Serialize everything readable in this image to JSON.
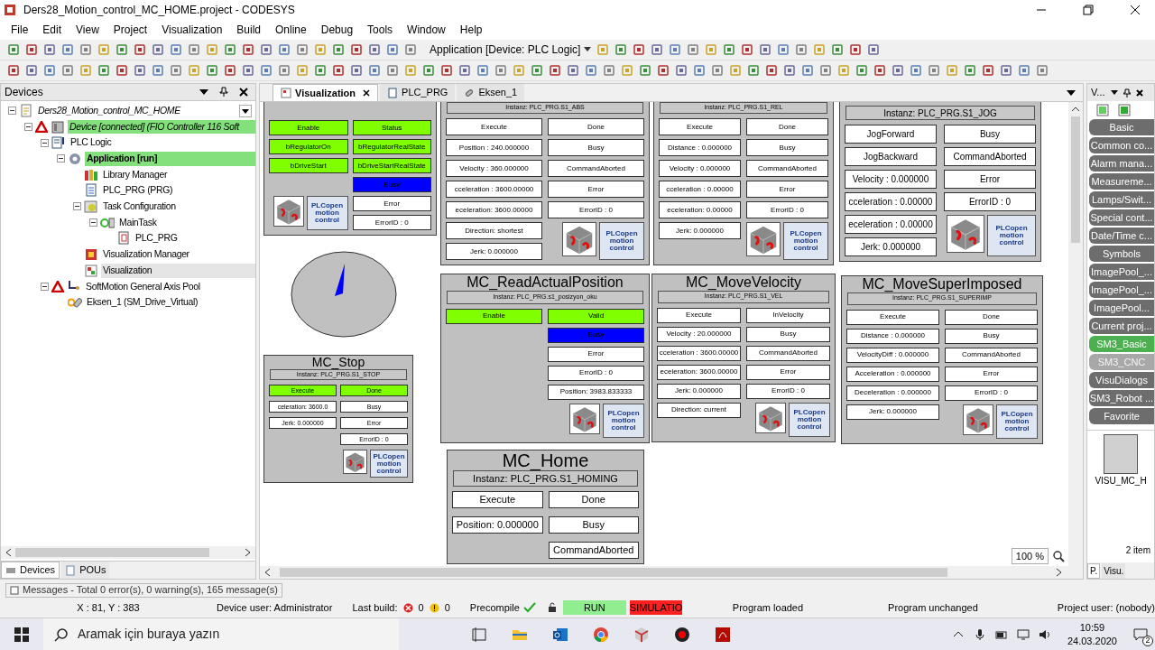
{
  "window": {
    "title": "Ders28_Motion_control_MC_HOME.project - CODESYS"
  },
  "menu": [
    "File",
    "Edit",
    "View",
    "Project",
    "Visualization",
    "Build",
    "Online",
    "Debug",
    "Tools",
    "Window",
    "Help"
  ],
  "toolbar": {
    "application": "Application [Device: PLC Logic]"
  },
  "devices_panel": {
    "title": "Devices",
    "tree": [
      {
        "label": "Ders28_Motion_control_MC_HOME",
        "kind": "project",
        "expanded": true,
        "children": [
          {
            "label": "Device [connected] (FIO Controller 116 Soft",
            "kind": "device",
            "warning": true,
            "highlighted": true,
            "expanded": true,
            "children": [
              {
                "label": "PLC Logic",
                "kind": "plc",
                "expanded": true,
                "children": [
                  {
                    "label": "Application [run]",
                    "kind": "application",
                    "highlighted": true,
                    "expanded": true,
                    "children": [
                      {
                        "label": "Library Manager",
                        "kind": "library"
                      },
                      {
                        "label": "PLC_PRG (PRG)",
                        "kind": "pou"
                      },
                      {
                        "label": "Task Configuration",
                        "kind": "taskconfig",
                        "expanded": true,
                        "children": [
                          {
                            "label": "MainTask",
                            "kind": "task",
                            "expanded": true,
                            "children": [
                              {
                                "label": "PLC_PRG",
                                "kind": "call"
                              }
                            ]
                          }
                        ]
                      },
                      {
                        "label": "Visualization Manager",
                        "kind": "visumanager"
                      },
                      {
                        "label": "Visualization",
                        "kind": "visu",
                        "selected": true
                      }
                    ]
                  }
                ]
              },
              {
                "label": "SoftMotion General Axis Pool",
                "kind": "axispool",
                "warning": true,
                "expanded": true,
                "children": [
                  {
                    "label": "Eksen_1 (SM_Drive_Virtual)",
                    "kind": "axis"
                  }
                ]
              }
            ]
          }
        ]
      }
    ]
  },
  "bottom_tabs": [
    {
      "label": "Devices",
      "selected": true
    },
    {
      "label": "POUs",
      "selected": false
    }
  ],
  "editor_tabs": [
    {
      "label": "Visualization",
      "selected": true
    },
    {
      "label": "PLC_PRG",
      "selected": false
    },
    {
      "label": "Eksen_1",
      "selected": false
    }
  ],
  "visualization": {
    "blocks": [
      {
        "left": [
          {
            "kind": "cell",
            "text": "Enable",
            "color": "#80ff00"
          },
          {
            "kind": "cell",
            "text": "bRegulatorOn",
            "color": "#80ff00"
          },
          {
            "kind": "cell",
            "text": "bDriveStart",
            "color": "#80ff00"
          },
          {
            "kind": "blank"
          },
          {
            "kind": "logos",
            "brand": "PLCopen",
            "caption": "motion control"
          }
        ],
        "right": [
          {
            "kind": "cell",
            "text": "Status",
            "color": "#80ff00"
          },
          {
            "kind": "cell",
            "text": "bRegulatorRealState",
            "color": "#80ff00"
          },
          {
            "kind": "cell",
            "text": "bDriveStartRealState",
            "color": "#80ff00"
          },
          {
            "kind": "cell",
            "text": "Busy",
            "color": "#0000ff"
          },
          {
            "kind": "cell",
            "text": "Error",
            "color": "#ffffff"
          },
          {
            "kind": "cell",
            "text": "ErrorID : 0",
            "color": "#ffffff"
          }
        ]
      },
      {
        "instance": "Instanz: PLC_PRG.S1_ABS",
        "left": [
          {
            "kind": "cell",
            "text": "Execute",
            "color": "#ffffff"
          },
          {
            "kind": "cell",
            "text": "Position : 240.000000",
            "color": "#ffffff"
          },
          {
            "kind": "cell",
            "text": "Velocity : 360.000000",
            "color": "#ffffff"
          },
          {
            "kind": "cell",
            "text": "cceleration : 3600.00000",
            "color": "#ffffff"
          },
          {
            "kind": "cell",
            "text": "eceleration: 3600.00000",
            "color": "#ffffff"
          },
          {
            "kind": "cell",
            "text": "Direction: shortest",
            "color": "#ffffff"
          },
          {
            "kind": "cell",
            "text": "Jerk: 0.000000",
            "color": "#ffffff"
          }
        ],
        "right": [
          {
            "kind": "cell",
            "text": "Done",
            "color": "#ffffff"
          },
          {
            "kind": "cell",
            "text": "Busy",
            "color": "#ffffff"
          },
          {
            "kind": "cell",
            "text": "CommandAborted",
            "color": "#ffffff"
          },
          {
            "kind": "cell",
            "text": "Error",
            "color": "#ffffff"
          },
          {
            "kind": "cell",
            "text": "ErrorID : 0",
            "color": "#ffffff"
          },
          {
            "kind": "logos",
            "brand": "PLCopen",
            "caption": "motion control"
          }
        ]
      },
      {
        "instance": "Instanz: PLC_PRG.S1_REL",
        "left": [
          {
            "kind": "cell",
            "text": "Execute",
            "color": "#ffffff"
          },
          {
            "kind": "cell",
            "text": "Distance : 0.000000",
            "color": "#ffffff"
          },
          {
            "kind": "cell",
            "text": "Velocity : 0.000000",
            "color": "#ffffff"
          },
          {
            "kind": "cell",
            "text": "cceleration : 0.00000",
            "color": "#ffffff"
          },
          {
            "kind": "cell",
            "text": "eceleration: 0.00000",
            "color": "#ffffff"
          },
          {
            "kind": "cell",
            "text": "Jerk: 0.000000",
            "color": "#ffffff"
          }
        ],
        "right": [
          {
            "kind": "cell",
            "text": "Done",
            "color": "#ffffff"
          },
          {
            "kind": "cell",
            "text": "Busy",
            "color": "#ffffff"
          },
          {
            "kind": "cell",
            "text": "CommandAborted",
            "color": "#ffffff"
          },
          {
            "kind": "cell",
            "text": "Error",
            "color": "#ffffff"
          },
          {
            "kind": "cell",
            "text": "ErrorID : 0",
            "color": "#ffffff"
          },
          {
            "kind": "logos",
            "brand": "PLCopen",
            "caption": "motion control"
          }
        ]
      },
      {
        "instance": "Instanz: PLC_PRG.S1_JOG",
        "left": [
          {
            "kind": "cell",
            "text": "JogForward",
            "color": "#ffffff"
          },
          {
            "kind": "cell",
            "text": "JogBackward",
            "color": "#ffffff"
          },
          {
            "kind": "cell",
            "text": "Velocity : 0.000000",
            "color": "#ffffff"
          },
          {
            "kind": "cell",
            "text": "cceleration : 0.00000",
            "color": "#ffffff"
          },
          {
            "kind": "cell",
            "text": "eceleration : 0.00000",
            "color": "#ffffff"
          },
          {
            "kind": "cell",
            "text": "Jerk: 0.000000",
            "color": "#ffffff"
          }
        ],
        "right": [
          {
            "kind": "cell",
            "text": "Busy",
            "color": "#ffffff"
          },
          {
            "kind": "cell",
            "text": "CommandAborted",
            "color": "#ffffff"
          },
          {
            "kind": "cell",
            "text": "Error",
            "color": "#ffffff"
          },
          {
            "kind": "cell",
            "text": "ErrorID : 0",
            "color": "#ffffff"
          },
          {
            "kind": "logos",
            "brand": "PLCopen",
            "caption": "motion control"
          }
        ]
      },
      {
        "title": "MC_Stop",
        "instance": "Instanz: PLC_PRG.S1_STOP",
        "left": [
          {
            "kind": "cell",
            "text": "Execute",
            "color": "#80ff00"
          },
          {
            "kind": "cell",
            "text": "celeration: 3600.0",
            "color": "#ffffff"
          },
          {
            "kind": "cell",
            "text": "Jerk: 0.000000",
            "color": "#ffffff"
          }
        ],
        "right": [
          {
            "kind": "cell",
            "text": "Done",
            "color": "#80ff00"
          },
          {
            "kind": "cell",
            "text": "Busy",
            "color": "#ffffff"
          },
          {
            "kind": "cell",
            "text": "Error",
            "color": "#ffffff"
          },
          {
            "kind": "cell",
            "text": "ErrorID : 0",
            "color": "#ffffff"
          },
          {
            "kind": "logos",
            "brand": "PLCopen",
            "caption": "motion control"
          }
        ]
      },
      {
        "title": "MC_ReadActualPosition",
        "instance": "Instanz: PLC_PRG.s1_posizyon_oku",
        "left": [
          {
            "kind": "cell",
            "text": "Enable",
            "color": "#80ff00"
          }
        ],
        "right": [
          {
            "kind": "cell",
            "text": "Valid",
            "color": "#80ff00"
          },
          {
            "kind": "cell",
            "text": "Busy",
            "color": "#0000ff"
          },
          {
            "kind": "cell",
            "text": "Error",
            "color": "#ffffff"
          },
          {
            "kind": "cell",
            "text": "ErrorID : 0",
            "color": "#ffffff"
          },
          {
            "kind": "cell",
            "text": "Position: 3983.833333",
            "color": "#ffffff"
          },
          {
            "kind": "logos",
            "brand": "PLCopen",
            "caption": "motion control"
          }
        ]
      },
      {
        "title": "MC_MoveVelocity",
        "instance": "Instanz: PLC_PRG.S1_VEL",
        "left": [
          {
            "kind": "cell",
            "text": "Execute",
            "color": "#ffffff"
          },
          {
            "kind": "cell",
            "text": "Velocity : 20.000000",
            "color": "#ffffff"
          },
          {
            "kind": "cell",
            "text": "cceleration : 3600.00000",
            "color": "#ffffff"
          },
          {
            "kind": "cell",
            "text": "eceleration: 3600.00000",
            "color": "#ffffff"
          },
          {
            "kind": "cell",
            "text": "Jerk: 0.000000",
            "color": "#ffffff"
          },
          {
            "kind": "cell",
            "text": "Direction: current",
            "color": "#ffffff"
          }
        ],
        "right": [
          {
            "kind": "cell",
            "text": "InVelocity",
            "color": "#ffffff"
          },
          {
            "kind": "cell",
            "text": "Busy",
            "color": "#ffffff"
          },
          {
            "kind": "cell",
            "text": "CommandAborted",
            "color": "#ffffff"
          },
          {
            "kind": "cell",
            "text": "Error",
            "color": "#ffffff"
          },
          {
            "kind": "cell",
            "text": "ErrorID : 0",
            "color": "#ffffff"
          },
          {
            "kind": "logos",
            "brand": "PLCopen",
            "caption": "motion control"
          }
        ]
      },
      {
        "title": "MC_MoveSuperImposed",
        "instance": "Instanz: PLC_PRG.S1_SUPERIMP",
        "left": [
          {
            "kind": "cell",
            "text": "Execute",
            "color": "#ffffff"
          },
          {
            "kind": "cell",
            "text": "Distance : 0.000000",
            "color": "#ffffff"
          },
          {
            "kind": "cell",
            "text": "VelocityDiff : 0.000000",
            "color": "#ffffff"
          },
          {
            "kind": "cell",
            "text": "Acceleration : 0.000000",
            "color": "#ffffff"
          },
          {
            "kind": "cell",
            "text": "Deceleration : 0.000000",
            "color": "#ffffff"
          },
          {
            "kind": "cell",
            "text": "Jerk: 0.000000",
            "color": "#ffffff"
          }
        ],
        "right": [
          {
            "kind": "cell",
            "text": "Done",
            "color": "#ffffff"
          },
          {
            "kind": "cell",
            "text": "Busy",
            "color": "#ffffff"
          },
          {
            "kind": "cell",
            "text": "CommandAborted",
            "color": "#ffffff"
          },
          {
            "kind": "cell",
            "text": "Error",
            "color": "#ffffff"
          },
          {
            "kind": "cell",
            "text": "ErrorID : 0",
            "color": "#ffffff"
          },
          {
            "kind": "logos",
            "brand": "PLCopen",
            "caption": "motion control"
          }
        ]
      },
      {
        "title": "MC_Home",
        "instance": "Instanz: PLC_PRG.S1_HOMING",
        "left": [
          {
            "kind": "cell",
            "text": "Execute",
            "color": "#ffffff"
          },
          {
            "kind": "cell",
            "text": "Position: 0.000000",
            "color": "#ffffff"
          }
        ],
        "right": [
          {
            "kind": "cell",
            "text": "Done",
            "color": "#ffffff"
          },
          {
            "kind": "cell",
            "text": "Busy",
            "color": "#ffffff"
          },
          {
            "kind": "cell",
            "text": "CommandAborted",
            "color": "#ffffff"
          }
        ]
      }
    ],
    "zoom": "100 %"
  },
  "toolbox": {
    "title": "V...",
    "items": [
      {
        "label": "Basic",
        "selected": false,
        "disabled": false
      },
      {
        "label": "Common co...",
        "selected": false,
        "disabled": false
      },
      {
        "label": "Alarm mana...",
        "selected": false,
        "disabled": false
      },
      {
        "label": "Measureme...",
        "selected": false,
        "disabled": false
      },
      {
        "label": "Lamps/Swit...",
        "selected": false,
        "disabled": false
      },
      {
        "label": "Special cont...",
        "selected": false,
        "disabled": false
      },
      {
        "label": "Date/Time c...",
        "selected": false,
        "disabled": false
      },
      {
        "label": "Symbols",
        "selected": false,
        "disabled": false
      },
      {
        "label": "ImagePool_...",
        "selected": false,
        "disabled": false
      },
      {
        "label": "ImagePool_...",
        "selected": false,
        "disabled": false
      },
      {
        "label": "ImagePool...",
        "selected": false,
        "disabled": false
      },
      {
        "label": "Current proj...",
        "selected": false,
        "disabled": false
      },
      {
        "label": "SM3_Basic",
        "selected": true,
        "disabled": false
      },
      {
        "label": "SM3_CNC",
        "selected": false,
        "disabled": true
      },
      {
        "label": "VisuDialogs",
        "selected": false,
        "disabled": false
      },
      {
        "label": "SM3_Robot ...",
        "selected": false,
        "disabled": false
      },
      {
        "label": "Favorite",
        "selected": false,
        "disabled": false
      }
    ],
    "thumbnail": "VISU_MC_H",
    "count": "2 item",
    "tabs": [
      {
        "label": "P.",
        "selected": true
      },
      {
        "label": "Visu.",
        "selected": false
      }
    ]
  },
  "messages": "Messages - Total 0 error(s), 0 warning(s), 165 message(s)",
  "status_bar": {
    "position": "X : 81, Y : 383",
    "device_user": "Device user: Administrator",
    "last_build": "Last build:",
    "errors": "0",
    "warnings": "0",
    "precompile": "Precompile",
    "run": "RUN",
    "simulation": "SIMULATIO",
    "program": "Program loaded",
    "changes": "Program unchanged",
    "project_user": "Project user: (nobody)"
  },
  "taskbar": {
    "search": "Aramak için buraya yazın",
    "time": "10:59",
    "date": "24.03.2020",
    "notifications": "2"
  }
}
